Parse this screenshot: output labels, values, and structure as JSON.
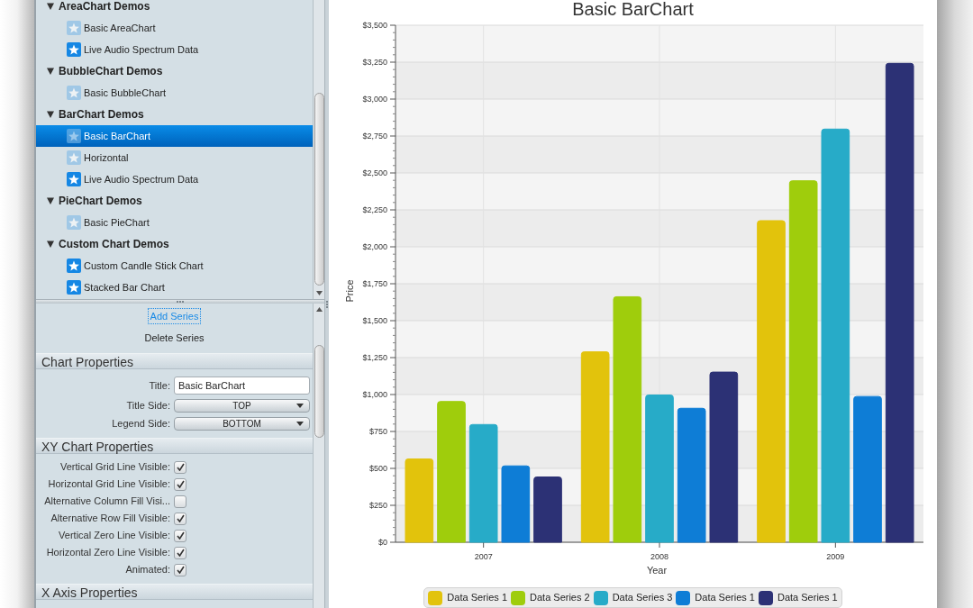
{
  "tree": [
    {
      "label": "AreaChart Demos",
      "expanded": true,
      "children": [
        {
          "label": "Basic AreaChart",
          "kind": "faded",
          "selected": false
        },
        {
          "label": "Live Audio Spectrum Data",
          "kind": "bright",
          "selected": false
        }
      ]
    },
    {
      "label": "BubbleChart Demos",
      "expanded": true,
      "children": [
        {
          "label": "Basic BubbleChart",
          "kind": "faded",
          "selected": false
        }
      ]
    },
    {
      "label": "BarChart Demos",
      "expanded": true,
      "children": [
        {
          "label": "Basic BarChart",
          "kind": "faded",
          "selected": true
        },
        {
          "label": "Horizontal",
          "kind": "faded",
          "selected": false
        },
        {
          "label": "Live Audio Spectrum Data",
          "kind": "bright",
          "selected": false
        }
      ]
    },
    {
      "label": "PieChart Demos",
      "expanded": true,
      "children": [
        {
          "label": "Basic PieChart",
          "kind": "faded",
          "selected": false
        }
      ]
    },
    {
      "label": "Custom Chart Demos",
      "expanded": true,
      "children": [
        {
          "label": "Custom Candle Stick Chart",
          "kind": "bright",
          "selected": false
        },
        {
          "label": "Stacked Bar Chart",
          "kind": "bright",
          "selected": false
        }
      ]
    }
  ],
  "series_buttons": [
    {
      "label": "Add Series",
      "focused": true
    },
    {
      "label": "Delete Series",
      "focused": false
    }
  ],
  "property_sections": [
    {
      "title": "Chart Properties",
      "rows": [
        {
          "kind": "text",
          "label": "Title:",
          "value": "Basic BarChart"
        },
        {
          "kind": "combo",
          "label": "Title Side:",
          "value": "TOP"
        },
        {
          "kind": "combo",
          "label": "Legend Side:",
          "value": "BOTTOM"
        }
      ]
    },
    {
      "title": "XY Chart Properties",
      "rows": [
        {
          "kind": "checkbox",
          "label": "Vertical Grid Line Visible:",
          "checked": true
        },
        {
          "kind": "checkbox",
          "label": "Horizontal Grid Line Visible:",
          "checked": true
        },
        {
          "kind": "checkbox",
          "label": "Alternative Column Fill Visi...",
          "checked": false
        },
        {
          "kind": "checkbox",
          "label": "Alternative Row Fill Visible:",
          "checked": true
        },
        {
          "kind": "checkbox",
          "label": "Vertical Zero Line Visible:",
          "checked": true
        },
        {
          "kind": "checkbox",
          "label": "Horizontal Zero Line Visible:",
          "checked": true
        },
        {
          "kind": "checkbox",
          "label": "Animated:",
          "checked": true
        }
      ]
    },
    {
      "title": "X Axis Properties"
    }
  ],
  "chart": {
    "chart_data": {
      "type": "bar",
      "title": "Basic BarChart",
      "xlabel": "Year",
      "ylabel": "Price",
      "categories": [
        "2007",
        "2008",
        "2009"
      ],
      "series": [
        {
          "name": "Data Series 1",
          "color": "#e2c30c",
          "values": [
            567,
            1292,
            2180
          ]
        },
        {
          "name": "Data Series 2",
          "color": "#9fcd0c",
          "values": [
            956,
            1665,
            2450
          ]
        },
        {
          "name": "Data Series 3",
          "color": "#27abc8",
          "values": [
            800,
            1000,
            2800
          ]
        },
        {
          "name": "Data Series 1",
          "color": "#0e7dd6",
          "values": [
            520,
            910,
            990
          ]
        },
        {
          "name": "Data Series 1",
          "color": "#2c3175",
          "values": [
            445,
            1155,
            3245
          ]
        }
      ],
      "ylim": [
        0,
        3500
      ],
      "yticks": [
        {
          "value": 0,
          "label": "$0"
        },
        {
          "value": 250,
          "label": "$250"
        },
        {
          "value": 500,
          "label": "$500"
        },
        {
          "value": 750,
          "label": "$750"
        },
        {
          "value": 1000,
          "label": "$1,000"
        },
        {
          "value": 1250,
          "label": "$1,250"
        },
        {
          "value": 1500,
          "label": "$1,500"
        },
        {
          "value": 1750,
          "label": "$1,750"
        },
        {
          "value": 2000,
          "label": "$2,000"
        },
        {
          "value": 2250,
          "label": "$2,250"
        },
        {
          "value": 2500,
          "label": "$2,500"
        },
        {
          "value": 2750,
          "label": "$2,750"
        },
        {
          "value": 3000,
          "label": "$3,000"
        },
        {
          "value": 3250,
          "label": "$3,250"
        },
        {
          "value": 3500,
          "label": "$3,500"
        }
      ],
      "grid": true,
      "legend": "bottom"
    }
  }
}
